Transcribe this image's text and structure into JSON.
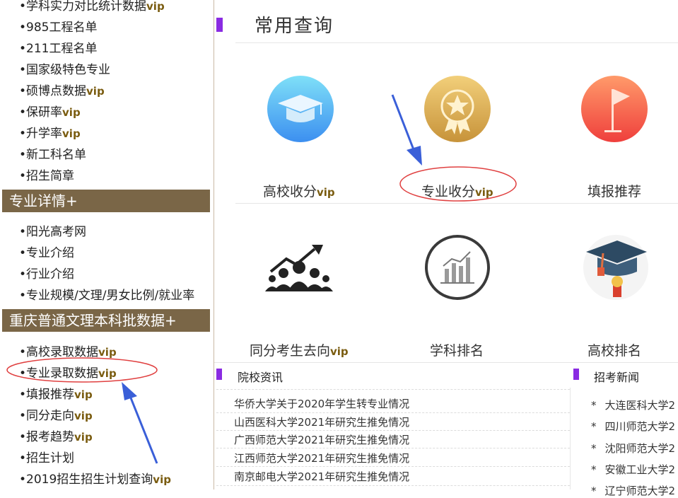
{
  "sidebar": {
    "vip_tag": "vip",
    "bullet": "•",
    "items_top": [
      {
        "label": "学科实力对比统计数据",
        "vip": true
      },
      {
        "label": "985工程名单",
        "vip": false
      },
      {
        "label": "211工程名单",
        "vip": false
      },
      {
        "label": "国家级特色专业",
        "vip": false
      },
      {
        "label": "硕博点数据",
        "vip": true
      },
      {
        "label": "保研率",
        "vip": true
      },
      {
        "label": "升学率",
        "vip": true
      },
      {
        "label": "新工科名单",
        "vip": false
      },
      {
        "label": "招生简章",
        "vip": false
      }
    ],
    "section1_title": "专业详情+",
    "items_mid": [
      {
        "label": "阳光高考网"
      },
      {
        "label": "专业介绍"
      },
      {
        "label": "行业介绍"
      },
      {
        "label": "专业规模/文理/男女比例/就业率"
      }
    ],
    "section2_title": "重庆普通文理本科批数据+",
    "items_bottom": [
      {
        "label": "高校录取数据",
        "vip": true
      },
      {
        "label": "专业录取数据",
        "vip": true
      },
      {
        "label": "填报推荐",
        "vip": true
      },
      {
        "label": "同分走向",
        "vip": true
      },
      {
        "label": "报考趋势",
        "vip": true
      },
      {
        "label": "招生计划",
        "vip": false
      },
      {
        "label": "2019招生招生计划查询",
        "vip": true
      }
    ]
  },
  "main": {
    "title": "常用查询",
    "tiles_row1": [
      {
        "label": "高校收分",
        "vip": true,
        "icon": "graduation-cap-icon"
      },
      {
        "label": "专业收分",
        "vip": true,
        "icon": "medal-star-icon"
      },
      {
        "label": "填报推荐",
        "vip": false,
        "icon": "flag-icon"
      }
    ],
    "tiles_row2": [
      {
        "label": "同分考生去向",
        "vip": true,
        "icon": "people-growth-icon"
      },
      {
        "label": "学科排名",
        "vip": false,
        "icon": "bar-chart-icon"
      },
      {
        "label": "高校排名",
        "vip": false,
        "icon": "mortarboard-icon"
      }
    ]
  },
  "school_news": {
    "title": "院校资讯",
    "items": [
      "华侨大学关于2020年学生转专业情况",
      "山西医科大学2021年研究生推免情况",
      "广西师范大学2021年研究生推免情况",
      "江西师范大学2021年研究生推免情况",
      "南京邮电大学2021年研究生推免情况"
    ]
  },
  "exam_news": {
    "title": "招考新闻",
    "star": "*",
    "items": [
      "大连医科大学2",
      "四川师范大学2",
      "沈阳师范大学2",
      "安徽工业大学2",
      "辽宁师范大学2"
    ]
  },
  "colors": {
    "section_header_bg": "#7a6647",
    "vip_text": "#7a5c10",
    "accent_bar": "#8a2be2",
    "annotation_arrow": "#3a5fd8",
    "annotation_circle": "#e04040"
  }
}
